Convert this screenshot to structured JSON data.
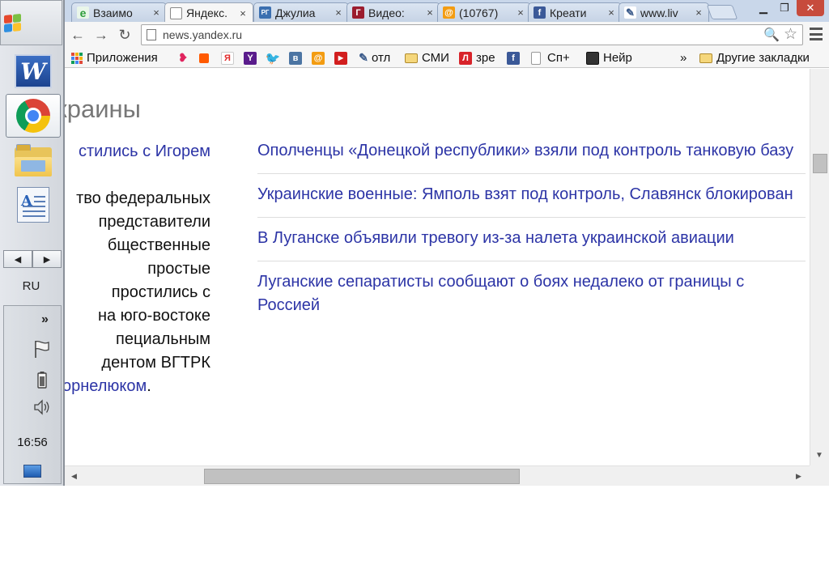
{
  "taskbar": {
    "language": "RU",
    "clock": "16:56",
    "tray_expand": "»",
    "task_scroll_left": "◀",
    "task_scroll_right": "▶",
    "apps": [
      "word-icon",
      "chrome-icon",
      "explorer-icon",
      "wordpad-icon"
    ]
  },
  "tabs": [
    {
      "label": "Взаимо",
      "icon": "e",
      "color": "#3ea84a"
    },
    {
      "label": "Яндекс.",
      "icon": "doc",
      "color": "#ffffff",
      "active": true
    },
    {
      "label": "Джулиа",
      "icon": "РГ",
      "color": "#3b6fb0"
    },
    {
      "label": "Видео:",
      "icon": "Г",
      "color": "#9b1c2e"
    },
    {
      "label": "(10767)",
      "icon": "@",
      "color": "#f39c12"
    },
    {
      "label": "Креати",
      "icon": "f",
      "color": "#3b5998"
    },
    {
      "label": "www.liv",
      "icon": "link",
      "color": "#ffffff"
    }
  ],
  "tab_close": "×",
  "window_controls": {
    "minimize": "▁",
    "maximize": "❐",
    "close": "✕"
  },
  "toolbar": {
    "back": "←",
    "forward": "→",
    "reload": "↻",
    "url": "news.yandex.ru",
    "zoom": "🔍",
    "star": "☆"
  },
  "bookmarks": {
    "apps_label": "Приложения",
    "items": [
      {
        "label": "",
        "icon": "lips-icon",
        "color": "#e0245e"
      },
      {
        "label": "",
        "icon": "square-icon",
        "color": "#ff5a00"
      },
      {
        "label": "",
        "icon": "Я",
        "color": "#e22b2b"
      },
      {
        "label": "",
        "icon": "Y",
        "color": "#5a1c8c"
      },
      {
        "label": "",
        "icon": "twitter-icon",
        "color": "#4aa3e8"
      },
      {
        "label": "",
        "icon": "в",
        "color": "#4c75a3"
      },
      {
        "label": "",
        "icon": "@",
        "color": "#f39c12"
      },
      {
        "label": "",
        "icon": "youtube-icon",
        "color": "#d21e1e"
      }
    ],
    "labeled": [
      {
        "label": "отл",
        "icon": "link-icon"
      },
      {
        "label": "СМИ",
        "icon": "folder-icon"
      },
      {
        "label": "зре",
        "icon": "Л"
      },
      {
        "label": "",
        "icon": "facebook-icon"
      },
      {
        "label": "Сп+",
        "icon": "page-icon"
      },
      {
        "label": "Нейр",
        "icon": "tv-icon"
      }
    ],
    "overflow": "»",
    "other_label": "Другие закладки"
  },
  "page": {
    "section_title": "токе Украины",
    "left_lines": [
      {
        "text": "стились с Игорем",
        "link": true
      },
      {
        "text": "",
        "link": false
      },
      {
        "text": "тво федеральных",
        "link": false
      },
      {
        "text": "представители",
        "link": false
      },
      {
        "text": "бщественные",
        "link": false
      },
      {
        "text": "простые",
        "link": false
      },
      {
        "text": "простились с",
        "link": false
      },
      {
        "text": "на юго-востоке",
        "link": false
      },
      {
        "text": "пециальным",
        "link": false
      },
      {
        "text": "дентом ВГТРК",
        "link": false
      }
    ],
    "left_last_link": "орнелюком",
    "left_last_tail": ".",
    "news": [
      {
        "text": "Ополченцы «Донецкой республики» взяли под контроль танковую базу"
      },
      {
        "text": "Украинские военные: Ямполь взят под контроль, Славянск блокирован"
      },
      {
        "text": "В Луганске объявили тревогу из-за налета украинской авиации"
      },
      {
        "text": "Луганские сепаратисты сообщают о боях недалеко от границы с Россией"
      }
    ]
  },
  "scrollbar": {
    "up": "▲",
    "down": "▼",
    "left": "◀",
    "right": "▶"
  }
}
